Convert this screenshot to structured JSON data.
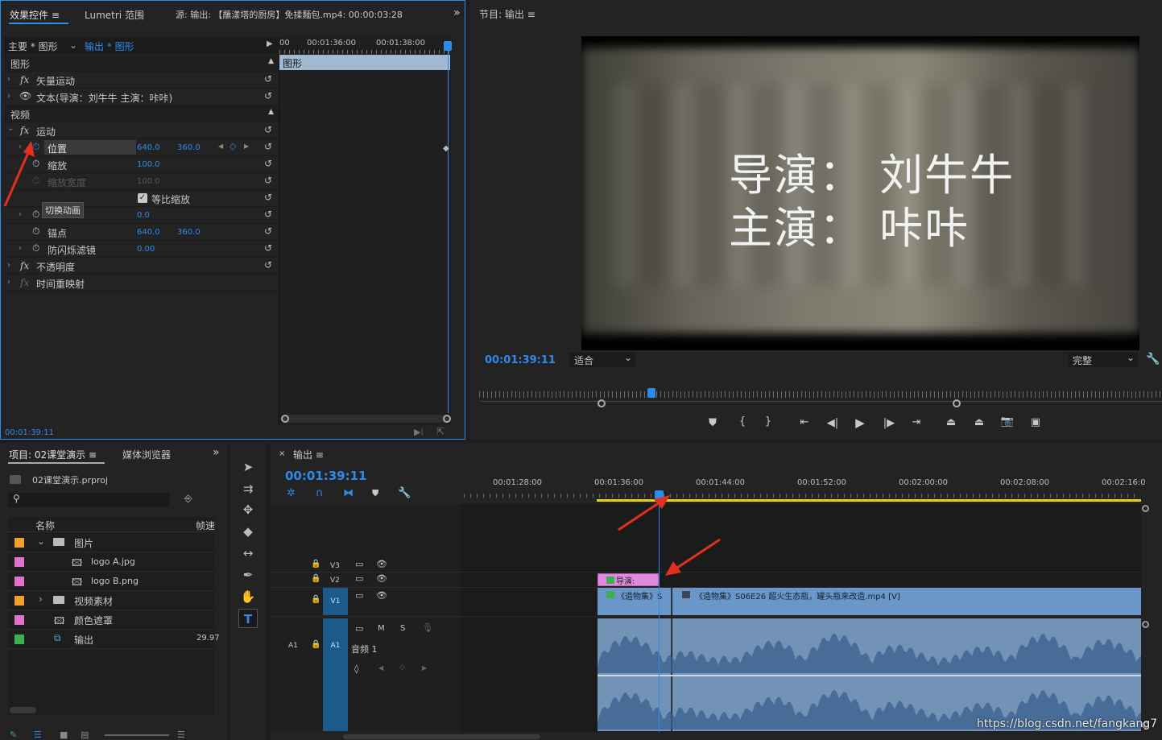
{
  "effect_controls": {
    "tab_effect": "效果控件",
    "tab_lumetri": "Lumetri 范围",
    "source": "源: 输出: 【蘸漾塔的厨房】免揉麵包.mp4: 00:00:03:28",
    "master": "主要 * 图形",
    "output": "输出 * 图形",
    "section_graphic": "图形",
    "vector_motion": "矢量运动",
    "text_layer": "文本(导演：刘牛牛 主演：咔咔)",
    "section_video": "视频",
    "motion": "运动",
    "position": "位置",
    "pos_x": "640.0",
    "pos_y": "360.0",
    "scale": "缩放",
    "scale_val": "100.0",
    "scale_width": "缩放宽度",
    "scale_width_val": "100.0",
    "uniform_scale": "等比缩放",
    "tooltip": "切换动画",
    "rotation_val": "0.0",
    "anchor": "锚点",
    "anchor_x": "640.0",
    "anchor_y": "360.0",
    "anti_flicker": "防闪烁滤镜",
    "anti_flicker_val": "0.00",
    "opacity": "不透明度",
    "time_remap": "时间重映射",
    "ruler_start": "00",
    "ruler_t1": "00:01:36:00",
    "ruler_t2": "00:01:38:00",
    "clip_label": "图形",
    "timecode": "00:01:39:11"
  },
  "program": {
    "title": "节目: 输出",
    "overlay_line1": "导演： 刘牛牛",
    "overlay_line2": "主演： 咔咔",
    "timecode": "00:01:39:11",
    "fit": "适合",
    "quality": "完整"
  },
  "project": {
    "tab_project": "项目: 02课堂演示",
    "tab_media": "媒体浏览器",
    "file": "02课堂演示.prproj",
    "col_name": "名称",
    "col_fps": "帧速",
    "items": [
      {
        "label": "图片",
        "color": "#f0a030"
      },
      {
        "label": "logo A.jpg",
        "color": "#e070d0"
      },
      {
        "label": "logo B.png",
        "color": "#e070d0"
      },
      {
        "label": "视频素材",
        "color": "#f0a030"
      },
      {
        "label": "颜色遮罩",
        "color": "#e070d0"
      },
      {
        "label": "输出",
        "color": "#3cb050",
        "fps": "29.97"
      }
    ]
  },
  "timeline": {
    "title": "输出",
    "timecode": "00:01:39:11",
    "ticks": [
      "00:01:28:00",
      "00:01:36:00",
      "00:01:44:00",
      "00:01:52:00",
      "00:02:00:00",
      "00:02:08:00",
      "00:02:16:0"
    ],
    "tracks": {
      "v3": "V3",
      "v2": "V2",
      "v1": "V1",
      "a1": "A1",
      "audio_name": "音频 1",
      "m": "M",
      "s": "S"
    },
    "clip_v2": "导演:",
    "clip_v1a": "《造物集》S",
    "clip_v1b": "《造物集》S06E26 超火生态瓶，罐头瓶来改造.mp4 [V]"
  },
  "watermark": "https://blog.csdn.net/fangkang7"
}
